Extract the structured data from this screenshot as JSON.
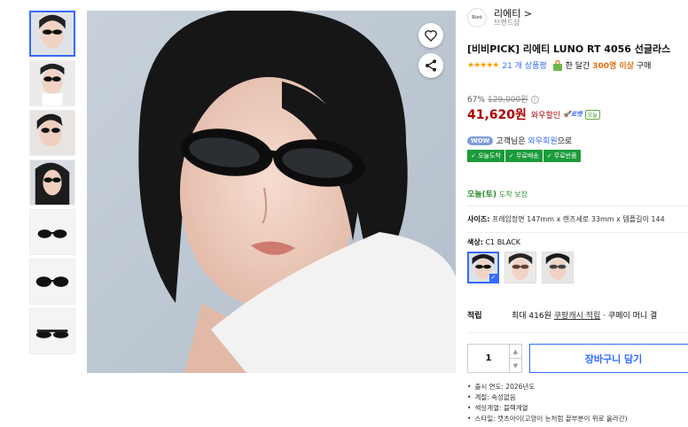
{
  "gallery": {
    "thumbnails": [
      {
        "type": "model",
        "selected": true
      },
      {
        "type": "model",
        "selected": false
      },
      {
        "type": "model",
        "selected": false
      },
      {
        "type": "model",
        "selected": false
      },
      {
        "type": "product",
        "selected": false
      },
      {
        "type": "product",
        "selected": false
      },
      {
        "type": "product",
        "selected": false
      }
    ],
    "actions": {
      "wishlist_icon": "heart-icon",
      "share_icon": "share-icon"
    }
  },
  "brand": {
    "logo_text": "Rieti",
    "name": "리에티 >",
    "sub": "브랜드샵"
  },
  "product": {
    "title": "[비비PICK] 리에티 LUNO RT 4056 선글라스",
    "stars": "★★★★★",
    "review_count": "21 개 상품평",
    "buy_prefix": "한 달간",
    "buy_highlight": "300명 이상",
    "buy_suffix": "구매"
  },
  "price": {
    "discount": "67%",
    "original": "129,000원",
    "final": "41,620원",
    "wow_label": "와우할인",
    "rocket_label": "🚀로켓",
    "today_label": "오늘"
  },
  "wow": {
    "pill": "WOW",
    "text_prefix": "고객님은",
    "text_brand": "와우회원",
    "text_suffix": "으로"
  },
  "benefit_badges": [
    "✓ 오늘도착",
    "✓ 무료배송",
    "✓ 무료반품"
  ],
  "delivery": {
    "date": "오늘(토)",
    "note": "도착 보장"
  },
  "size": {
    "label": "사이즈:",
    "value": "프레임정면 147mm x 렌즈세로 33mm x 템플길이 144"
  },
  "color": {
    "label": "색상:",
    "value": "C1 BLACK",
    "selected_index": 0
  },
  "points": {
    "label": "적립",
    "prefix": "최대 416원",
    "link": "쿠팡캐시 적립",
    "suffix": "· 쿠페이 머니 결"
  },
  "purchase": {
    "quantity": "1",
    "up": "▲",
    "down": "▼",
    "cart_button": "장바구니 담기"
  },
  "details": [
    "출시 연도: 2026년도",
    "계절: 속성없음",
    "색상계열: 블랙계열",
    "스타일: 캣츠아이(고양이 눈처럼 끝부분이 위로 올라간)"
  ],
  "colors": {
    "accent": "#346aff",
    "price_red": "#ae0000",
    "star_orange": "#ff9d00",
    "badge_green": "#1b9b3b"
  }
}
